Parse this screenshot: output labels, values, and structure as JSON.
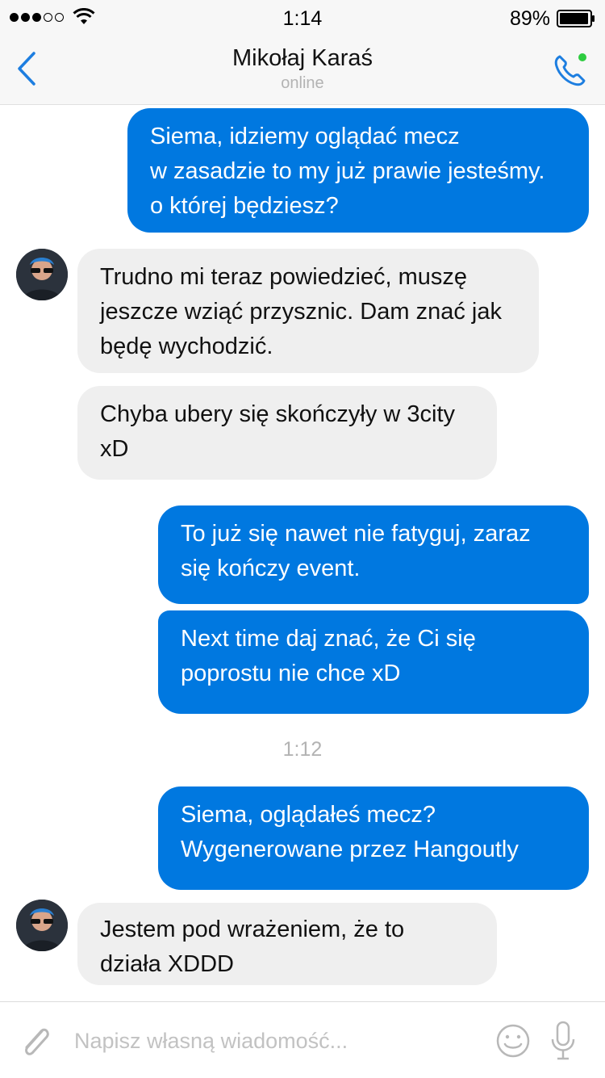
{
  "status_bar": {
    "time": "1:14",
    "battery_percent": "89%",
    "signal_bars_filled": 3,
    "signal_bars_total": 5
  },
  "header": {
    "contact_name": "Mikołaj Karaś",
    "contact_status": "online",
    "back_icon": "chevron-left-icon",
    "call_icon": "phone-icon",
    "presence_color": "#2ecc40"
  },
  "colors": {
    "accent": "#0078e0",
    "outgoing_bubble": "#0078e0",
    "incoming_bubble": "#efefef"
  },
  "messages": [
    {
      "direction": "out",
      "lines": [
        "Siema, idziemy oglądać mecz",
        "w zasadzie to my już prawie jesteśmy.",
        "o której będziesz?"
      ]
    },
    {
      "direction": "in",
      "lines": [
        "Trudno mi teraz powiedzieć, muszę",
        "jeszcze wziąć przysznic. Dam znać jak",
        "będę wychodzić."
      ]
    },
    {
      "direction": "in",
      "lines": [
        "Chyba ubery się skończyły w 3city",
        "xD"
      ]
    },
    {
      "direction": "out",
      "lines": [
        "To już się nawet nie fatyguj, zaraz",
        "się kończy event."
      ]
    },
    {
      "direction": "out",
      "lines": [
        "Next time daj znać, że Ci się",
        "poprostu nie chce xD"
      ]
    },
    {
      "direction": "out",
      "lines": [
        "Siema, oglądałeś mecz?",
        "Wygenerowane przez Hangoutly"
      ]
    },
    {
      "direction": "in",
      "lines": [
        "Jestem pod wrażeniem, że to",
        "działa XDDD"
      ]
    }
  ],
  "timestamp": "1:12",
  "composer": {
    "placeholder": "Napisz własną wiadomość...",
    "value": "",
    "attach_icon": "paperclip-icon",
    "emoji_icon": "smiley-icon",
    "mic_icon": "microphone-icon"
  }
}
